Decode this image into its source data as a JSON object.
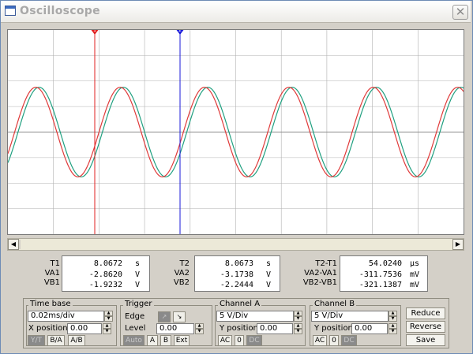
{
  "window": {
    "title": "Oscilloscope",
    "close_glyph": "✕"
  },
  "colors": {
    "channel_a": "#e03a3a",
    "channel_b": "#20a080",
    "cursor_1": "#e02020",
    "cursor_2": "#1a1ad8",
    "grid": "#b0b0b0",
    "screen_bg": "#ffffff"
  },
  "cursors": {
    "cursor1_label": "1",
    "cursor2_label": "2"
  },
  "waveform": {
    "periods_visible": 5.4,
    "phase_lead_b": 0.04,
    "amplitude_div": 1.3
  },
  "measurements": {
    "t1": {
      "rows": [
        {
          "label": "T1",
          "value": "8.0672",
          "unit": "s"
        },
        {
          "label": "VA1",
          "value": "-2.8620",
          "unit": "V"
        },
        {
          "label": "VB1",
          "value": "-1.9232",
          "unit": "V"
        }
      ]
    },
    "t2": {
      "rows": [
        {
          "label": "T2",
          "value": "8.0673",
          "unit": "s"
        },
        {
          "label": "VA2",
          "value": "-3.1738",
          "unit": "V"
        },
        {
          "label": "VB2",
          "value": "-2.2444",
          "unit": "V"
        }
      ]
    },
    "diff": {
      "rows": [
        {
          "label": "T2-T1",
          "value": "54.0240",
          "unit": "µs"
        },
        {
          "label": "VA2-VA1",
          "value": "-311.7536",
          "unit": "mV"
        },
        {
          "label": "VB2-VB1",
          "value": "-321.1387",
          "unit": "mV"
        }
      ]
    }
  },
  "timebase": {
    "title": "Time base",
    "scale": "0.02ms/div",
    "xpos_label": "X position",
    "xpos_value": "0.00",
    "modes": [
      "Y/T",
      "B/A",
      "A/B"
    ]
  },
  "trigger": {
    "title": "Trigger",
    "edge_label": "Edge",
    "level_label": "Level",
    "level_value": "0.00",
    "buttons": [
      "Auto",
      "A",
      "B",
      "Ext"
    ]
  },
  "channel_a": {
    "title": "Channel A",
    "scale": "5 V/Div",
    "ypos_label": "Y position",
    "ypos_value": "0.00",
    "coupling": [
      "AC",
      "0",
      "DC"
    ]
  },
  "channel_b": {
    "title": "Channel B",
    "scale": "5 V/Div",
    "ypos_label": "Y position",
    "ypos_value": "0.00",
    "coupling": [
      "AC",
      "0",
      "DC"
    ]
  },
  "actions": {
    "reduce": "Reduce",
    "reverse": "Reverse",
    "save": "Save"
  }
}
